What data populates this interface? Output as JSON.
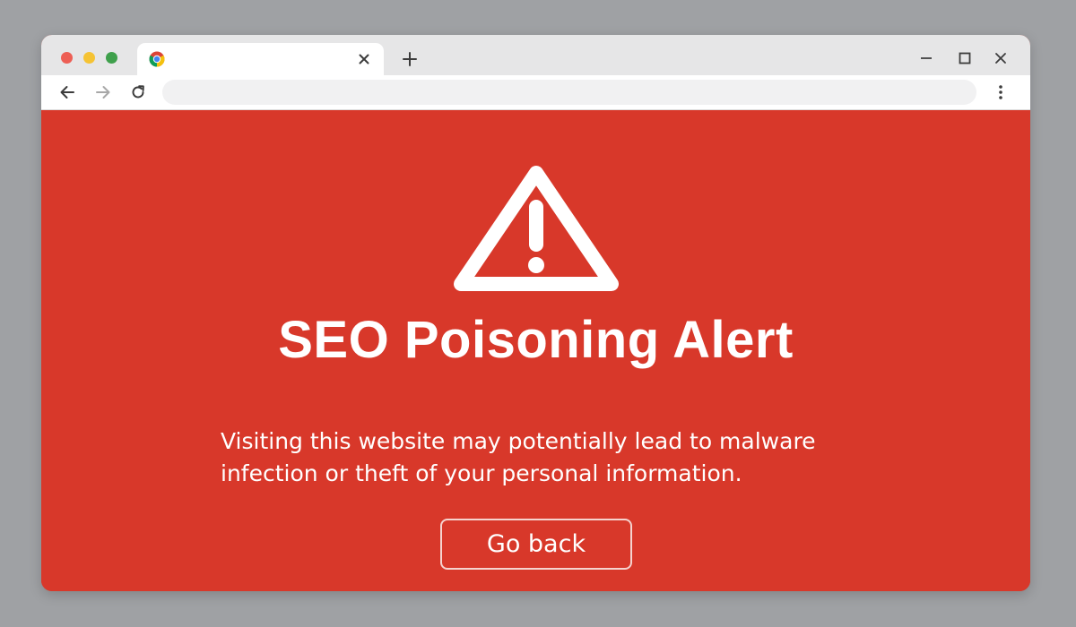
{
  "window": {
    "traffic_lights": {
      "close_color": "#ed5f55",
      "minimize_color": "#f5c334",
      "zoom_color": "#3fa04c"
    },
    "tab": {
      "favicon": "chrome-icon",
      "close_icon": "close-icon",
      "title": ""
    },
    "new_tab_icon": "plus-icon",
    "controls": {
      "minimize_icon": "minimize-icon",
      "maximize_icon": "maximize-icon",
      "close_icon": "close-icon"
    }
  },
  "toolbar": {
    "back_icon": "arrow-left-icon",
    "forward_icon": "arrow-right-icon",
    "reload_icon": "reload-icon",
    "address_value": "",
    "menu_icon": "kebab-menu-icon"
  },
  "alert": {
    "icon": "warning-triangle-icon",
    "title": "SEO Poisoning Alert",
    "message": "Visiting this website may potentially lead to malware infection or theft of your personal information.",
    "button_label": "Go back",
    "background_color": "#d8382a",
    "text_color": "#ffffff"
  }
}
